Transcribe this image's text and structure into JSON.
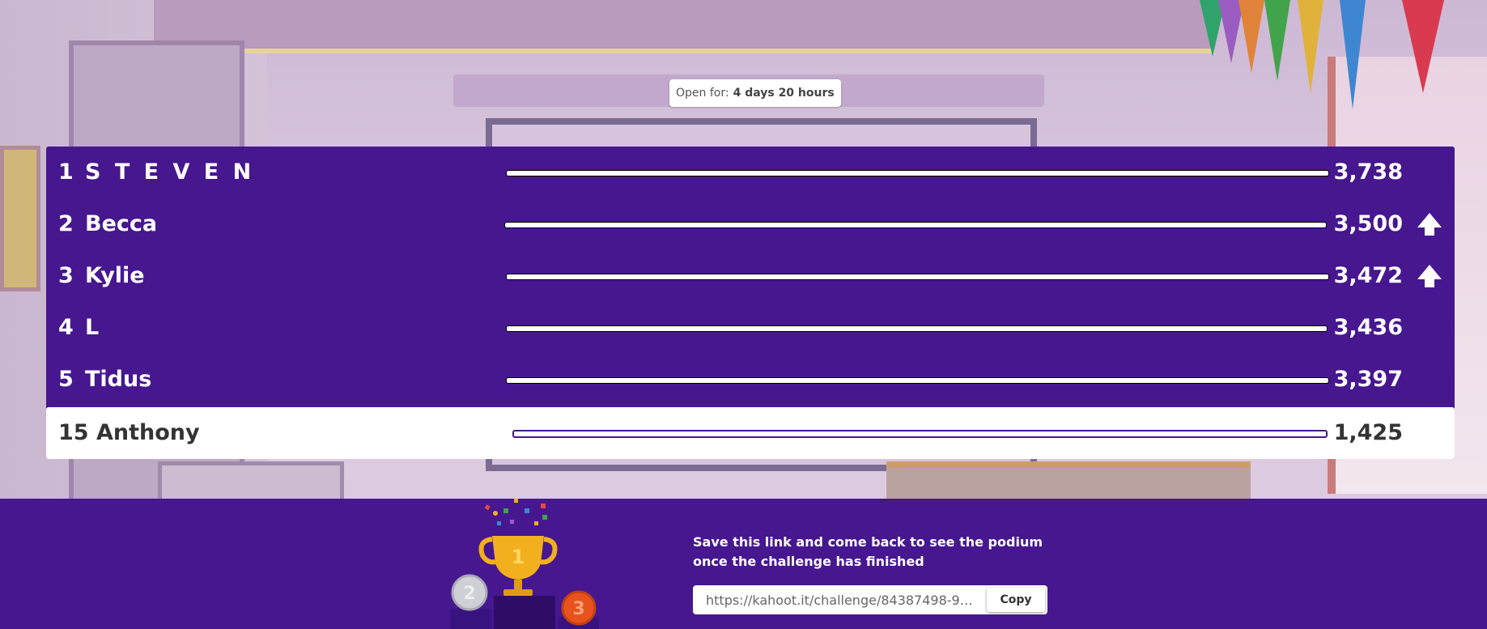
{
  "open_for": {
    "label": "Open for:",
    "value": "4 days 20 hours"
  },
  "leaderboard": [
    {
      "rank": "1",
      "name": "S T E V E N",
      "score": "3,738",
      "trend": "none"
    },
    {
      "rank": "2",
      "name": "Becca",
      "score": "3,500",
      "trend": "up"
    },
    {
      "rank": "3",
      "name": "Kylie",
      "score": "3,472",
      "trend": "up"
    },
    {
      "rank": "4",
      "name": "L",
      "score": "3,436",
      "trend": "none"
    },
    {
      "rank": "5",
      "name": "Tidus",
      "score": "3,397",
      "trend": "none"
    }
  ],
  "current_player": {
    "rank": "15",
    "name": "Anthony",
    "score": "1,425"
  },
  "footer": {
    "message_line1": "Save this link and come back to see the podium",
    "message_line2": "once the challenge has finished",
    "link_value": "https://kahoot.it/challenge/84387498-97 ...",
    "copy_label": "Copy"
  },
  "podium": {
    "first": "1",
    "second": "2",
    "third": "3"
  },
  "colors": {
    "brand_purple": "#46178f",
    "trophy_gold": "#f2b01e",
    "bronze": "#e8521d"
  }
}
